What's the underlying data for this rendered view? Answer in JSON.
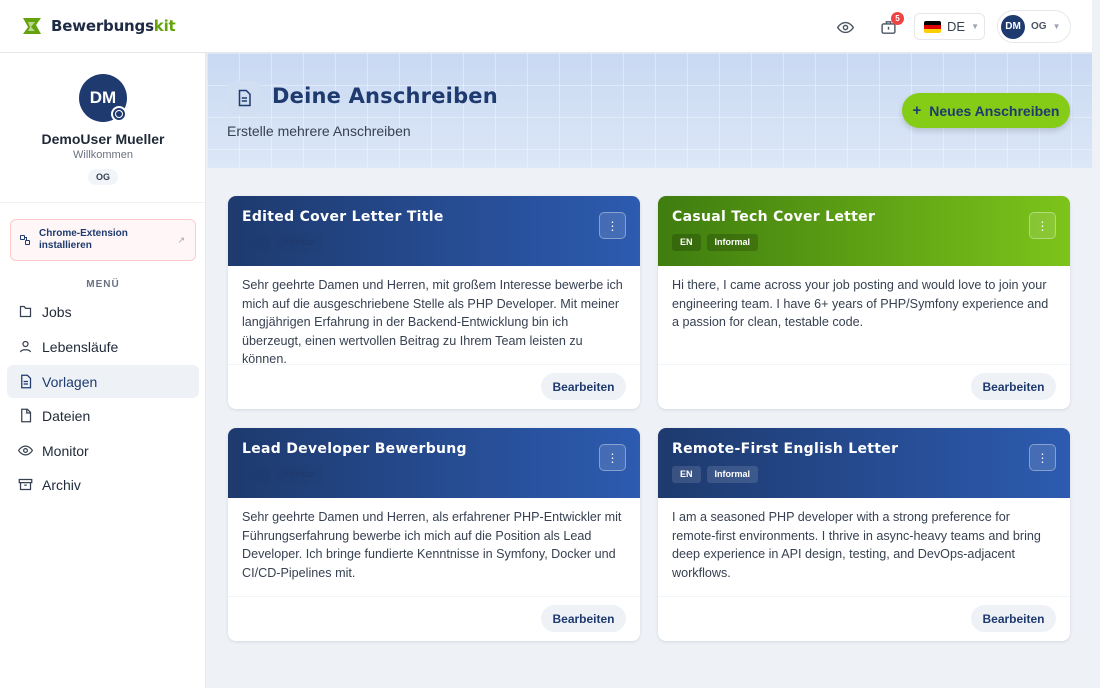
{
  "app": {
    "brand_main": "Bewerbungs",
    "brand_accent": "kit",
    "notification_count": "5",
    "language": "DE",
    "user_initials": "DM",
    "user_tag": "OG"
  },
  "sidebar": {
    "avatar_initials": "DM",
    "user_name": "DemoUser Mueller",
    "greeting": "Willkommen",
    "badge": "OG",
    "extension_label": "Chrome-Extension installieren",
    "menu_title": "MENÜ",
    "items": [
      {
        "label": "Jobs",
        "icon": "folder-icon"
      },
      {
        "label": "Lebensläufe",
        "icon": "user-icon"
      },
      {
        "label": "Vorlagen",
        "icon": "document-icon",
        "active": true
      },
      {
        "label": "Dateien",
        "icon": "file-icon"
      },
      {
        "label": "Monitor",
        "icon": "eye-icon"
      },
      {
        "label": "Archiv",
        "icon": "archive-icon"
      }
    ]
  },
  "header": {
    "title": "Deine Anschreiben",
    "subtitle": "Erstelle mehrere Anschreiben",
    "new_button": "Neues Anschreiben"
  },
  "cards": [
    {
      "title": "Edited Cover Letter Title",
      "lang": "DE",
      "tone": "Formal",
      "theme": "blue",
      "body": "Sehr geehrte Damen und Herren, mit großem Interesse bewerbe ich mich auf die ausgeschriebene Stelle als PHP Developer. Mit meiner langjährigen Erfahrung in der Backend-Entwicklung bin ich überzeugt, einen wertvollen Beitrag zu Ihrem Team leisten zu können.",
      "action": "Bearbeiten"
    },
    {
      "title": "Casual Tech Cover Letter",
      "lang": "EN",
      "tone": "Informal",
      "theme": "green",
      "body": "Hi there, I came across your job posting and would love to join your engineering team. I have 6+ years of PHP/Symfony experience and a passion for clean, testable code.",
      "action": "Bearbeiten"
    },
    {
      "title": "Lead Developer Bewerbung",
      "lang": "DE",
      "tone": "Formal",
      "theme": "blue",
      "body": "Sehr geehrte Damen und Herren, als erfahrener PHP-Entwickler mit Führungserfahrung bewerbe ich mich auf die Position als Lead Developer. Ich bringe fundierte Kenntnisse in Symfony, Docker und CI/CD-Pipelines mit.",
      "action": "Bearbeiten"
    },
    {
      "title": "Remote-First English Letter",
      "lang": "EN",
      "tone": "Informal",
      "theme": "blue",
      "body": "I am a seasoned PHP developer with a strong preference for remote-first environments. I thrive in async-heavy teams and bring deep experience in API design, testing, and DevOps-adjacent workflows.",
      "action": "Bearbeiten"
    }
  ]
}
